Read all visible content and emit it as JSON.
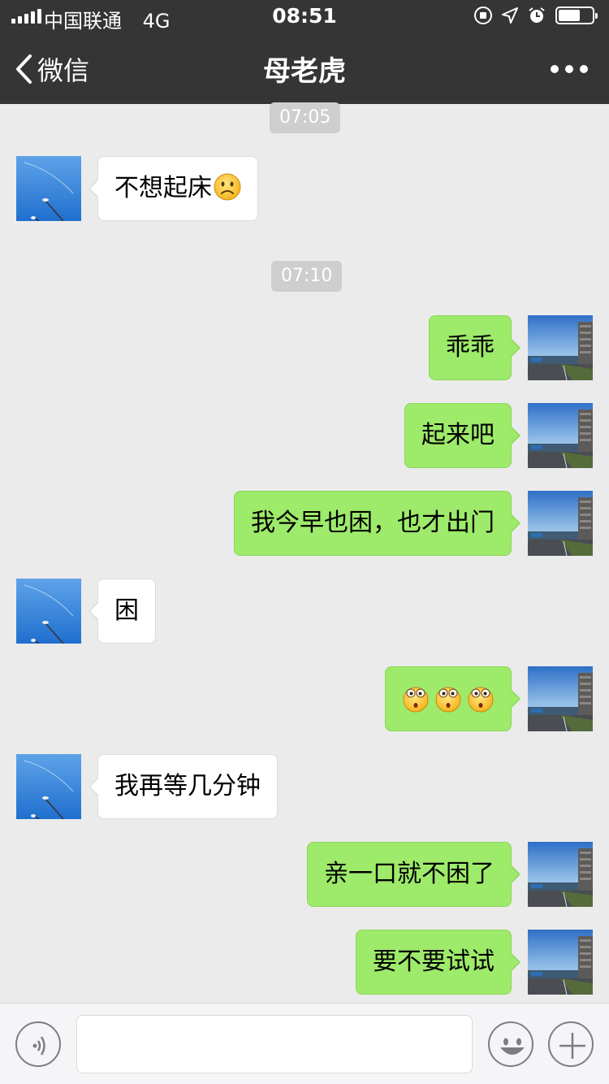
{
  "status_bar": {
    "carrier": "中国联通",
    "network": "4G",
    "time": "08:51",
    "icons": [
      "signal-icon",
      "rotation-lock-icon",
      "location-icon",
      "alarm-icon",
      "battery-icon"
    ],
    "battery_level": 0.6
  },
  "nav": {
    "back_label": "微信",
    "title": "母老虎",
    "more_icon": "more-dots-icon"
  },
  "colors": {
    "nav_bg": "#353535",
    "chat_bg": "#ebebeb",
    "outgoing_bubble": "#9eea6a",
    "incoming_bubble": "#ffffff",
    "time_pill": "#cecece"
  },
  "timestamps": [
    "07:05",
    "07:10"
  ],
  "messages": [
    {
      "side": "in",
      "text": "不想起床",
      "emoji": "frown-emoji"
    },
    {
      "side": "out",
      "text": "乖乖"
    },
    {
      "side": "out",
      "text": "起来吧"
    },
    {
      "side": "out",
      "text": "我今早也困，也才出门"
    },
    {
      "side": "in",
      "text": "困"
    },
    {
      "side": "out",
      "text": "",
      "emoji": "shocked-emoji x3"
    },
    {
      "side": "in",
      "text": "我再等几分钟"
    },
    {
      "side": "out",
      "text": "亲一口就不困了"
    },
    {
      "side": "out",
      "text": "要不要试试"
    }
  ],
  "input_bar": {
    "placeholder": "",
    "voice_icon": "voice-icon",
    "emoji_icon": "smiley-icon",
    "plus_icon": "plus-icon"
  }
}
